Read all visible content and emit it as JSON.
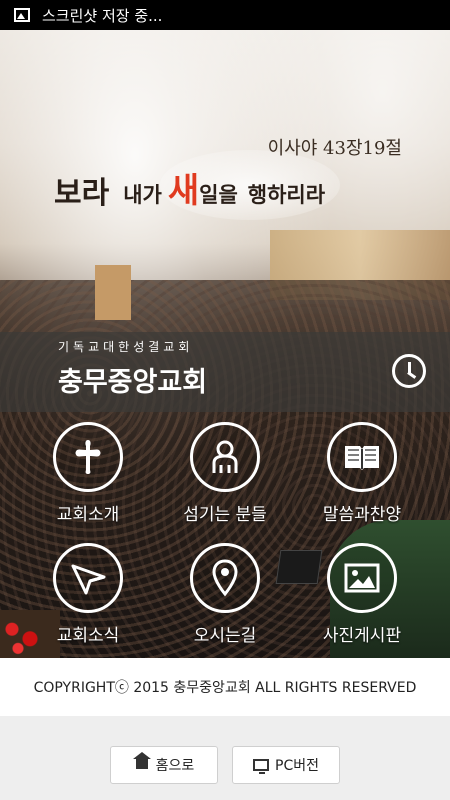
{
  "status_bar": {
    "text": "스크린샷 저장 중..."
  },
  "hero": {
    "verse_reference": "이사야 43장19절",
    "verse_part1": "보라",
    "verse_part2": "내가",
    "verse_accent": "새",
    "verse_part3": "일을",
    "verse_part4": "행하리라"
  },
  "church": {
    "subtitle": "기독교대한성결교회",
    "name": "충무중앙교회"
  },
  "menu": [
    {
      "label": "교회소개",
      "icon": "cross-icon"
    },
    {
      "label": "섬기는 분들",
      "icon": "person-icon"
    },
    {
      "label": "말씀과찬양",
      "icon": "book-icon"
    },
    {
      "label": "교회소식",
      "icon": "paper-plane-icon"
    },
    {
      "label": "오시는길",
      "icon": "location-pin-icon"
    },
    {
      "label": "사진게시판",
      "icon": "image-icon"
    }
  ],
  "footer": {
    "copyright": "COPYRIGHTⓒ 2015 충무중앙교회 ALL RIGHTS RESERVED"
  },
  "buttons": {
    "home": "홈으로",
    "pc": "PC버전"
  },
  "colors": {
    "accent": "#e03a1f",
    "band": "#3c3a37"
  }
}
